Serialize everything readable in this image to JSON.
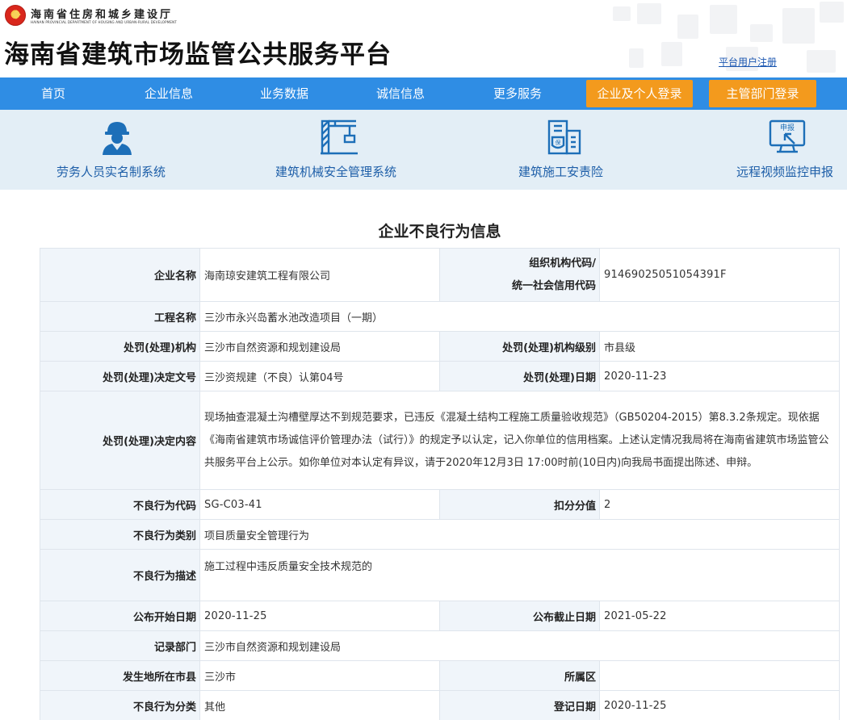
{
  "header": {
    "dept_name_cn": "海南省住房和城乡建设厅",
    "dept_name_en": "HAINAN PROVINCIAL DEPARTMENT OF HOUSING AND URBAN-RURAL DEVELOPMENT",
    "platform_title": "海南省建筑市场监管公共服务平台",
    "register_link": "平台用户注册"
  },
  "nav": {
    "items": [
      "首页",
      "企业信息",
      "业务数据",
      "诚信信息",
      "更多服务"
    ],
    "login_company": "企业及个人登录",
    "login_admin": "主管部门登录"
  },
  "systems": [
    {
      "icon": "worker-icon",
      "label": "劳务人员实名制系统"
    },
    {
      "icon": "crane-icon",
      "label": "建筑机械安全管理系统"
    },
    {
      "icon": "building-insurance-icon",
      "label": "建筑施工安责险"
    },
    {
      "icon": "video-report-icon",
      "label": "远程视频监控申报",
      "icon_text": "申报"
    }
  ],
  "page_title": "企业不良行为信息",
  "record": {
    "company_name_label": "企业名称",
    "company_name": "海南琼安建筑工程有限公司",
    "org_code_label_1": "组织机构代码/",
    "org_code_label_2": "统一社会信用代码",
    "org_code": "91469025051054391F",
    "project_name_label": "工程名称",
    "project_name": "三沙市永兴岛蓄水池改造项目（一期）",
    "penalty_org_label": "处罚(处理)机构",
    "penalty_org": "三沙市自然资源和规划建设局",
    "penalty_level_label": "处罚(处理)机构级别",
    "penalty_level": "市县级",
    "decision_no_label": "处罚(处理)决定文号",
    "decision_no": "三沙资规建（不良）认第04号",
    "penalty_date_label": "处罚(处理)日期",
    "penalty_date": "2020-11-23",
    "decision_content_label": "处罚(处理)决定内容",
    "decision_content": "现场抽查混凝土沟槽壁厚达不到规范要求，已违反《混凝土结构工程施工质量验收规范》（GB50204-2015）第8.3.2条规定。现依据《海南省建筑市场诚信评价管理办法（试行）》的规定予以认定，记入你单位的信用档案。上述认定情况我局将在海南省建筑市场监管公共服务平台上公示。如你单位对本认定有异议，请于2020年12月3日 17:00时前(10日内)向我局书面提出陈述、申辩。",
    "behavior_code_label": "不良行为代码",
    "behavior_code": "SG-C03-41",
    "deduction_label": "扣分分值",
    "deduction": "2",
    "behavior_category_label": "不良行为类别",
    "behavior_category": "项目质量安全管理行为",
    "behavior_desc_label": "不良行为描述",
    "behavior_desc": "施工过程中违反质量安全技术规范的",
    "publish_start_label": "公布开始日期",
    "publish_start": "2020-11-25",
    "publish_end_label": "公布截止日期",
    "publish_end": "2021-05-22",
    "record_dept_label": "记录部门",
    "record_dept": "三沙市自然资源和规划建设局",
    "city_label": "发生地所在市县",
    "city": "三沙市",
    "district_label": "所属区",
    "district": "",
    "behavior_class_label": "不良行为分类",
    "behavior_class": "其他",
    "register_date_label": "登记日期",
    "register_date": "2020-11-25"
  }
}
